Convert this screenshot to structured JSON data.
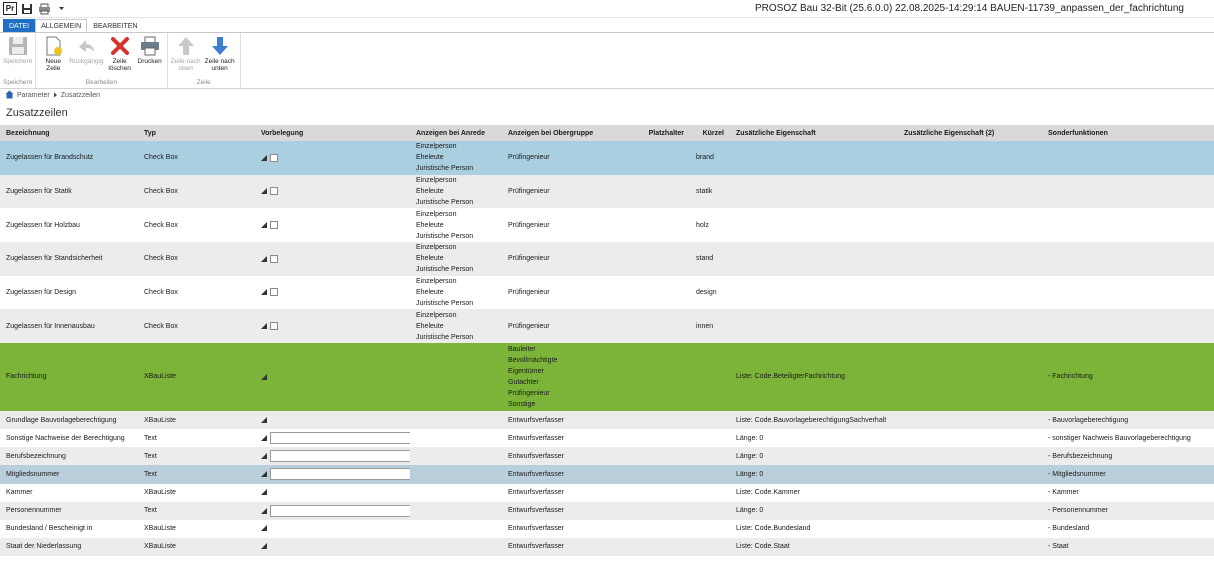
{
  "window": {
    "title": "PROSOZ Bau 32-Bit (25.6.0.0) 22.08.2025-14:29:14 BAUEN-11739_anpassen_der_fachrichtung",
    "logo": "Pr"
  },
  "tabs": {
    "file": "DATEI",
    "general": "ALLGEMEIN",
    "edit": "BEARBEITEN"
  },
  "ribbon": {
    "groups": {
      "save": "Speichern",
      "edit": "Bearbeiten",
      "row": "Zeile"
    },
    "buttons": {
      "save": "Speichern",
      "new_row": "Neue Zeile",
      "undo": "Rückgängig",
      "delete_row": "Zeile löschen",
      "print": "Drucken",
      "row_up": "Zeile nach oben",
      "row_down": "Zeile nach unten"
    }
  },
  "breadcrumb": {
    "root": "Parameter",
    "current": "Zusatzzeilen"
  },
  "page": {
    "title": "Zusatzzeilen"
  },
  "table": {
    "headers": {
      "bezeichnung": "Bezeichnung",
      "typ": "Typ",
      "vorbelegung": "Vorbelegung",
      "anrede": "Anzeigen bei Anrede",
      "obergruppe": "Anzeigen bei Obergruppe",
      "platzhalter": "Platzhalter",
      "kuerzel": "Kürzel",
      "eigenschaft": "Zusätzliche Eigenschaft",
      "eigenschaft2": "Zusätzliche Eigenschaft (2)",
      "sonder": "Sonderfunktionen"
    },
    "rows": [
      {
        "bezeichnung": "Zugelassen für Brandschutz",
        "typ": "Check Box",
        "vorbelegung": "checkbox",
        "anrede": [
          "Einzelperson",
          "Eheleute",
          "Juristische Person"
        ],
        "obergruppe": [
          "Prüfingenieur"
        ],
        "platzhalter": "",
        "kuerzel": "brand",
        "eigenschaft": "",
        "eigenschaft2": "",
        "sonder": ""
      },
      {
        "bezeichnung": "Zugelassen für Statik",
        "typ": "Check Box",
        "vorbelegung": "checkbox",
        "anrede": [
          "Einzelperson",
          "Eheleute",
          "Juristische Person"
        ],
        "obergruppe": [
          "Prüfingenieur"
        ],
        "platzhalter": "",
        "kuerzel": "statik",
        "eigenschaft": "",
        "eigenschaft2": "",
        "sonder": ""
      },
      {
        "bezeichnung": "Zugelassen für Holzbau",
        "typ": "Check Box",
        "vorbelegung": "checkbox",
        "anrede": [
          "Einzelperson",
          "Eheleute",
          "Juristische Person"
        ],
        "obergruppe": [
          "Prüfingenieur"
        ],
        "platzhalter": "",
        "kuerzel": "holz",
        "eigenschaft": "",
        "eigenschaft2": "",
        "sonder": ""
      },
      {
        "bezeichnung": "Zugelassen für Standsicherheit",
        "typ": "Check Box",
        "vorbelegung": "checkbox",
        "anrede": [
          "Einzelperson",
          "Eheleute",
          "Juristische Person"
        ],
        "obergruppe": [
          "Prüfingenieur"
        ],
        "platzhalter": "",
        "kuerzel": "stand",
        "eigenschaft": "",
        "eigenschaft2": "",
        "sonder": ""
      },
      {
        "bezeichnung": "Zugelassen für Design",
        "typ": "Check Box",
        "vorbelegung": "checkbox",
        "anrede": [
          "Einzelperson",
          "Eheleute",
          "Juristische Person"
        ],
        "obergruppe": [
          "Prüfingenieur"
        ],
        "platzhalter": "",
        "kuerzel": "design",
        "eigenschaft": "",
        "eigenschaft2": "",
        "sonder": ""
      },
      {
        "bezeichnung": "Zugelassen für Innenausbau",
        "typ": "Check Box",
        "vorbelegung": "checkbox",
        "anrede": [
          "Einzelperson",
          "Eheleute",
          "Juristische Person"
        ],
        "obergruppe": [
          "Prüfingenieur"
        ],
        "platzhalter": "",
        "kuerzel": "innen",
        "eigenschaft": "",
        "eigenschaft2": "",
        "sonder": ""
      },
      {
        "bezeichnung": "Fachrichtung",
        "typ": "XBauListe",
        "vorbelegung": "dropdown",
        "anrede": [],
        "obergruppe": [
          "Bauleiter",
          "Bevollmächtigte",
          "Eigentümer",
          "Gutachter",
          "Prüfingenieur",
          "Sonstige"
        ],
        "platzhalter": "",
        "kuerzel": "",
        "eigenschaft": "Liste: Code.BeteiligterFachrichtung",
        "eigenschaft2": "",
        "sonder": "- Fachrichtung"
      },
      {
        "bezeichnung": "Grundlage Bauvorlageberechtigung",
        "typ": "XBauListe",
        "vorbelegung": "dropdown",
        "anrede": [],
        "obergruppe": [
          "Entwurfsverfasser"
        ],
        "platzhalter": "",
        "kuerzel": "",
        "eigenschaft": "Liste: Code.BauvorlageberechtigungSachverhalt",
        "eigenschaft2": "",
        "sonder": "- Bauvorlageberechtigung"
      },
      {
        "bezeichnung": "Sonstige Nachweise der Berechtigung",
        "typ": "Text",
        "vorbelegung": "text",
        "anrede": [],
        "obergruppe": [
          "Entwurfsverfasser"
        ],
        "platzhalter": "",
        "kuerzel": "",
        "eigenschaft": "Länge: 0",
        "eigenschaft2": "",
        "sonder": "- sonstiger Nachweis Bauvorlageberechtigung"
      },
      {
        "bezeichnung": "Berufsbezeichnung",
        "typ": "Text",
        "vorbelegung": "text",
        "anrede": [],
        "obergruppe": [
          "Entwurfsverfasser"
        ],
        "platzhalter": "",
        "kuerzel": "",
        "eigenschaft": "Länge: 0",
        "eigenschaft2": "",
        "sonder": "- Berufsbezeichnung"
      },
      {
        "bezeichnung": "Mitgliedsnummer",
        "typ": "Text",
        "vorbelegung": "text",
        "anrede": [],
        "obergruppe": [
          "Entwurfsverfasser"
        ],
        "platzhalter": "",
        "kuerzel": "",
        "eigenschaft": "Länge: 0",
        "eigenschaft2": "",
        "sonder": "- Mitgliedsnummer"
      },
      {
        "bezeichnung": "Kammer",
        "typ": "XBauListe",
        "vorbelegung": "dropdown",
        "anrede": [],
        "obergruppe": [
          "Entwurfsverfasser"
        ],
        "platzhalter": "",
        "kuerzel": "",
        "eigenschaft": "Liste: Code.Kammer",
        "eigenschaft2": "",
        "sonder": "- Kammer"
      },
      {
        "bezeichnung": "Personennummer",
        "typ": "Text",
        "vorbelegung": "text",
        "anrede": [],
        "obergruppe": [
          "Entwurfsverfasser"
        ],
        "platzhalter": "",
        "kuerzel": "",
        "eigenschaft": "Länge: 0",
        "eigenschaft2": "",
        "sonder": "- Personennummer"
      },
      {
        "bezeichnung": "Bundesland / Bescheinigt in",
        "typ": "XBauListe",
        "vorbelegung": "dropdown",
        "anrede": [],
        "obergruppe": [
          "Entwurfsverfasser"
        ],
        "platzhalter": "",
        "kuerzel": "",
        "eigenschaft": "Liste: Code.Bundesland",
        "eigenschaft2": "",
        "sonder": "- Bundesland"
      },
      {
        "bezeichnung": "Staat der Niederlassung",
        "typ": "XBauListe",
        "vorbelegung": "dropdown",
        "anrede": [],
        "obergruppe": [
          "Entwurfsverfasser"
        ],
        "platzhalter": "",
        "kuerzel": "",
        "eigenschaft": "Liste: Code.Staat",
        "eigenschaft2": "",
        "sonder": "- Staat"
      }
    ]
  },
  "colors": {
    "accent": "#1f6fc5",
    "row_selected": "#aacfe0",
    "row_highlight": "#7cb43a",
    "row_alt": "#ececec",
    "row_focus": "#b9cfdb",
    "header": "#d9d9d9"
  }
}
